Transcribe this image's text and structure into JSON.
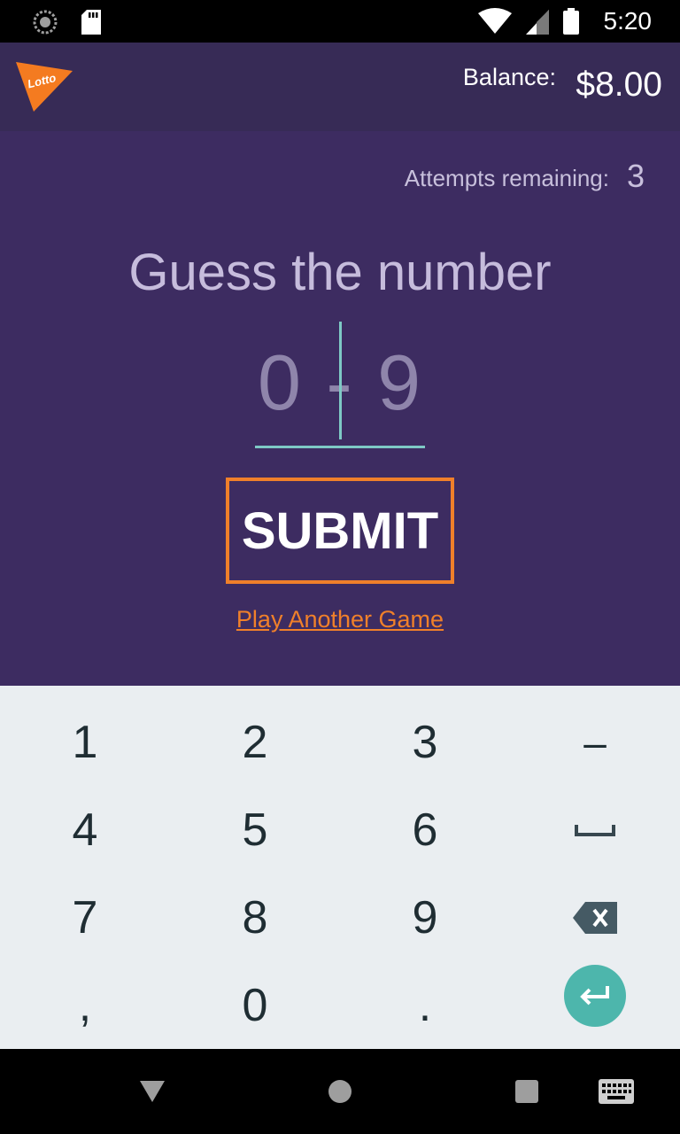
{
  "status_bar": {
    "time": "5:20",
    "icons": [
      "loading-icon",
      "sd-card-icon",
      "wifi-icon",
      "signal-icon",
      "battery-icon"
    ]
  },
  "app_bar": {
    "logo_text": "Lotto",
    "balance_label": "Balance:",
    "balance_value": "$8.00"
  },
  "main": {
    "attempts_label": "Attempts remaining:",
    "attempts_value": "3",
    "title": "Guess the number",
    "input_placeholder": "0 - 9",
    "submit_label": "SUBMIT",
    "play_another_label": "Play Another Game"
  },
  "keyboard": {
    "keys": [
      [
        "1",
        "2",
        "3",
        "–"
      ],
      [
        "4",
        "5",
        "6",
        "space"
      ],
      [
        "7",
        "8",
        "9",
        "backspace"
      ],
      [
        ",",
        "0",
        ".",
        "enter"
      ]
    ]
  },
  "nav_bar": {
    "icons": [
      "back-icon",
      "home-icon",
      "recents-icon",
      "keyboard-icon"
    ]
  },
  "colors": {
    "app_bar": "#372b56",
    "main_bg": "#3d2c61",
    "accent_orange": "#f0802a",
    "accent_teal": "#7ec9c5",
    "keyboard_bg": "#eaeef1"
  }
}
